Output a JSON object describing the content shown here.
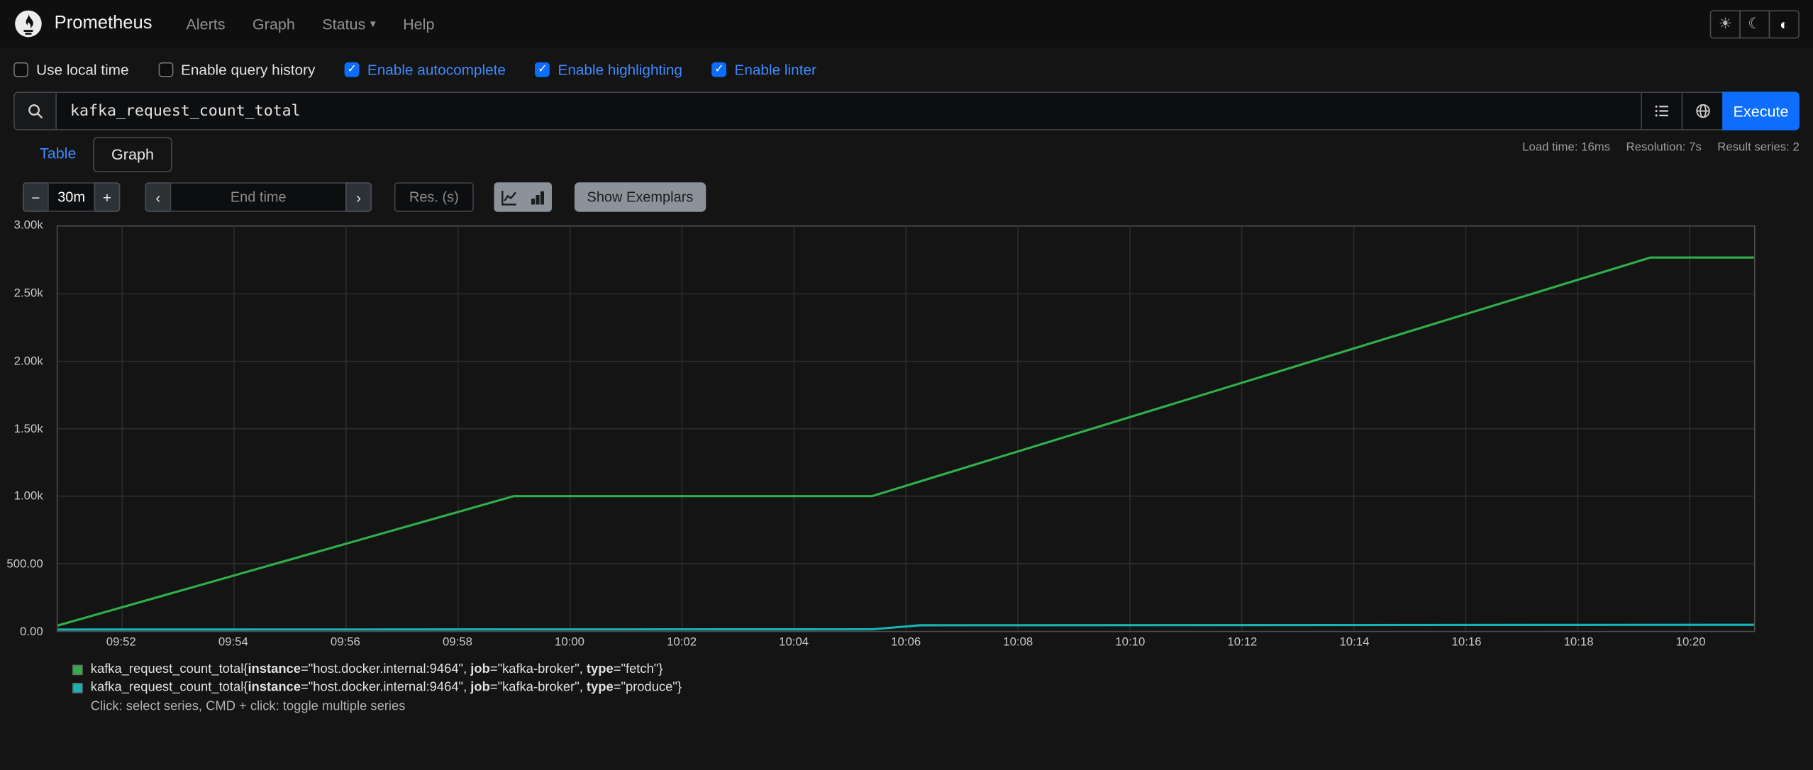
{
  "icons": {
    "sun": "☀",
    "moon": "☾",
    "theme_auto": "◐",
    "caret_down": "▾",
    "chevron_left": "‹",
    "chevron_right": "›",
    "minus": "−",
    "plus": "+"
  },
  "navbar": {
    "brand": "Prometheus",
    "items": [
      {
        "label": "Alerts"
      },
      {
        "label": "Graph"
      },
      {
        "label": "Status",
        "dropdown": true
      },
      {
        "label": "Help"
      }
    ]
  },
  "options": {
    "checkboxes": [
      {
        "label": "Use local time",
        "checked": false
      },
      {
        "label": "Enable query history",
        "checked": false
      },
      {
        "label": "Enable autocomplete",
        "checked": true
      },
      {
        "label": "Enable highlighting",
        "checked": true
      },
      {
        "label": "Enable linter",
        "checked": true
      }
    ]
  },
  "query": {
    "value": "kafka_request_count_total",
    "execute_label": "Execute"
  },
  "stats": {
    "load_time": "Load time: 16ms",
    "resolution": "Resolution: 7s",
    "result_series": "Result series: 2"
  },
  "tabs": [
    {
      "label": "Table",
      "active": false
    },
    {
      "label": "Graph",
      "active": true
    }
  ],
  "graph_controls": {
    "range": "30m",
    "end_time_placeholder": "End time",
    "res_placeholder": "Res. (s)",
    "show_exemplars_label": "Show Exemplars"
  },
  "chart_data": {
    "type": "line",
    "title": "",
    "xlabel": "",
    "ylabel": "",
    "grid": true,
    "legend_position": "bottom",
    "x_axis": {
      "tick_labels": [
        "09:52",
        "09:54",
        "09:56",
        "09:58",
        "10:00",
        "10:02",
        "10:04",
        "10:06",
        "10:08",
        "10:10",
        "10:12",
        "10:14",
        "10:16",
        "10:18",
        "10:20"
      ],
      "tick_minutes": [
        1.15,
        3.15,
        5.15,
        7.15,
        9.15,
        11.15,
        13.15,
        15.15,
        17.15,
        19.15,
        21.15,
        23.15,
        25.15,
        27.15,
        29.15
      ],
      "span_minutes": 30.3
    },
    "y_axis": {
      "tick_labels": [
        "0.00",
        "500.00",
        "1.00k",
        "1.50k",
        "2.00k",
        "2.50k",
        "3.00k"
      ],
      "tick_values": [
        0,
        500,
        1000,
        1500,
        2000,
        2500,
        3000
      ],
      "max": 3000,
      "ylim": [
        0,
        3000
      ]
    },
    "series": [
      {
        "metric": "kafka_request_count_total",
        "labels": [
          [
            "instance",
            "host.docker.internal:9464"
          ],
          [
            "job",
            "kafka-broker"
          ],
          [
            "type",
            "fetch"
          ]
        ],
        "color": "#2fae4a",
        "points_min_value": [
          [
            0,
            40
          ],
          [
            8.15,
            1000
          ],
          [
            14.55,
            1000
          ],
          [
            28.45,
            2770
          ],
          [
            30.3,
            2770
          ]
        ]
      },
      {
        "metric": "kafka_request_count_total",
        "labels": [
          [
            "instance",
            "host.docker.internal:9464"
          ],
          [
            "job",
            "kafka-broker"
          ],
          [
            "type",
            "produce"
          ]
        ],
        "color": "#18b1b5",
        "points_min_value": [
          [
            0,
            10
          ],
          [
            14.55,
            12
          ],
          [
            15.4,
            42
          ],
          [
            30.3,
            45
          ]
        ]
      }
    ],
    "legend_hint": "Click: select series, CMD + click: toggle multiple series"
  }
}
